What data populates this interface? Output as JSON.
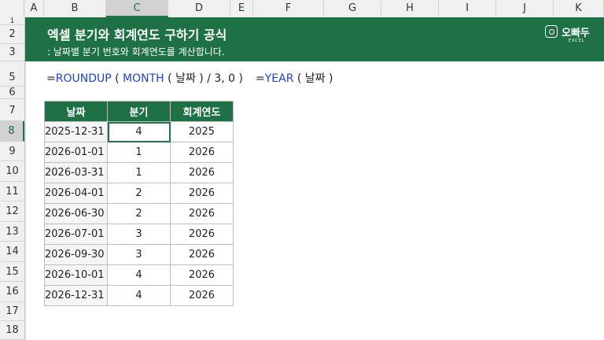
{
  "columns": [
    "A",
    "B",
    "C",
    "D",
    "E",
    "F",
    "G",
    "H",
    "I",
    "J",
    "K"
  ],
  "rows": [
    "1",
    "2",
    "3",
    "5",
    "6",
    "7",
    "8",
    "9",
    "10",
    "11",
    "12",
    "13",
    "14",
    "15",
    "16",
    "17",
    "18"
  ],
  "banner": {
    "title": "엑셀 분기와 회계연도 구하기 공식",
    "subtitle": ": 날짜별 분기 번호와 회계연도를 계산합니다.",
    "logo_text": "오빠두",
    "logo_sub": "EXCEL"
  },
  "formula": {
    "f1_eq": "=",
    "f1_fn": "ROUNDUP",
    "f1_a": " ( ",
    "f1_fn2": "MONTH",
    "f1_b": " ( 날짜 ) / 3, 0 )",
    "f2_eq": "=",
    "f2_fn": "YEAR",
    "f2_b": " ( 날짜 )"
  },
  "table": {
    "headers": [
      "날짜",
      "분기",
      "회계연도"
    ],
    "rows": [
      [
        "2025-12-31",
        "4",
        "2025"
      ],
      [
        "2026-01-01",
        "1",
        "2026"
      ],
      [
        "2026-03-31",
        "1",
        "2026"
      ],
      [
        "2026-04-01",
        "2",
        "2026"
      ],
      [
        "2026-06-30",
        "2",
        "2026"
      ],
      [
        "2026-07-01",
        "3",
        "2026"
      ],
      [
        "2026-09-30",
        "3",
        "2026"
      ],
      [
        "2026-10-01",
        "4",
        "2026"
      ],
      [
        "2026-12-31",
        "4",
        "2026"
      ]
    ]
  },
  "colors": {
    "banner": "#1e7145",
    "accent": "#217346",
    "formula_fn": "#1f3fe0"
  }
}
